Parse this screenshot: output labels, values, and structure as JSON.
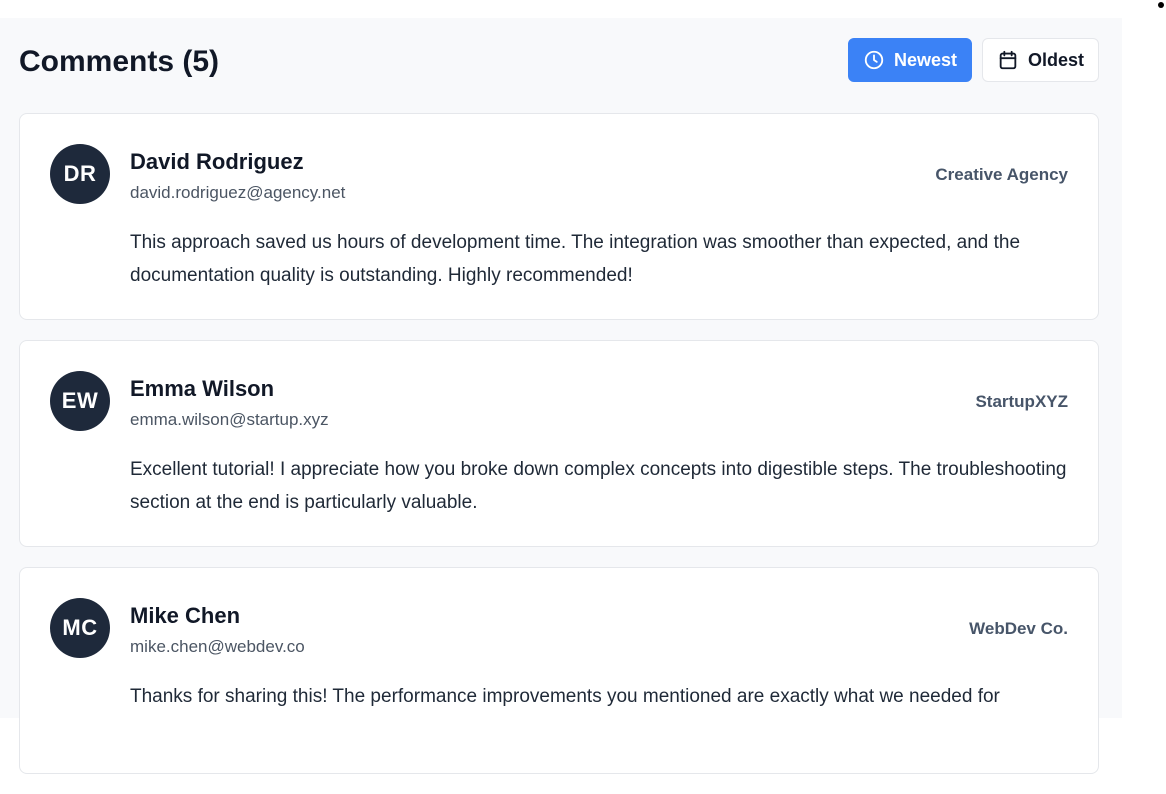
{
  "header": {
    "title": "Comments (5)",
    "sort_newest_label": "Newest",
    "sort_oldest_label": "Oldest"
  },
  "comments": [
    {
      "initials": "DR",
      "name": "David Rodriguez",
      "email": "david.rodriguez@agency.net",
      "company": "Creative Agency",
      "text": "This approach saved us hours of development time. The integration was smoother than expected, and the documentation quality is outstanding. Highly recommended!"
    },
    {
      "initials": "EW",
      "name": "Emma Wilson",
      "email": "emma.wilson@startup.xyz",
      "company": "StartupXYZ",
      "text": "Excellent tutorial! I appreciate how you broke down complex concepts into digestible steps. The troubleshooting section at the end is particularly valuable."
    },
    {
      "initials": "MC",
      "name": "Mike Chen",
      "email": "mike.chen@webdev.co",
      "company": "WebDev Co.",
      "text": "Thanks for sharing this! The performance improvements you mentioned are exactly what we needed for"
    }
  ],
  "icons": {
    "newest": "clock-icon",
    "oldest": "calendar-icon"
  },
  "colors": {
    "accent": "#3b82f6",
    "avatar_bg": "#1e293b",
    "panel_bg": "#f8f9fb"
  }
}
